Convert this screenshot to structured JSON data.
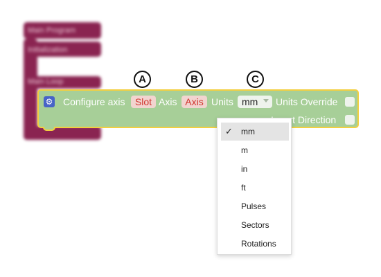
{
  "background_program": {
    "main_program_label": "Main Program",
    "initialization_label": "Initialization",
    "main_loop_label": "Main Loop"
  },
  "block": {
    "prefix": "Configure axis",
    "slot_label": "Slot",
    "axis_word": "Axis",
    "axis_value": "Axis",
    "units_word": "Units",
    "units_value": "mm",
    "units_override_label": "Units Override",
    "invert_direction_label": "Invert Direction"
  },
  "markers": [
    "A",
    "B",
    "C"
  ],
  "dropdown": {
    "selected": "mm",
    "options": [
      "mm",
      "m",
      "in",
      "ft",
      "Pulses",
      "Sectors",
      "Rotations"
    ]
  },
  "colors": {
    "block_fill": "#a7cf98",
    "block_outline": "#f3cf3f",
    "background_block": "#8a2451",
    "field_red_text": "#d0352d",
    "gear_icon": "#4763c7"
  }
}
